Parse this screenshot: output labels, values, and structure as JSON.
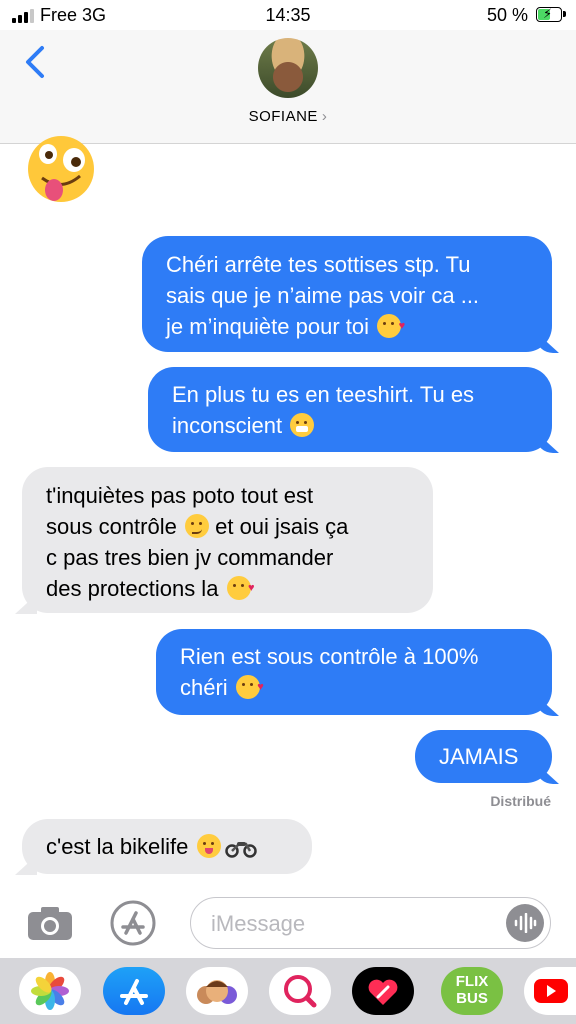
{
  "status_bar": {
    "carrier": "Free",
    "network": "3G",
    "time": "14:35",
    "battery": "50 %",
    "battery_level_percent": 50
  },
  "header": {
    "contact_name": "SOFIANE",
    "chevron": "›",
    "back_icon": "chevron-left-icon",
    "avatar": "contact-photo"
  },
  "conversation": {
    "top_emoji": "zany-face-emoji",
    "messages": [
      {
        "sender": "me",
        "text": "Chéri arrête tes sottises stp. Tu\nsais que je n’aime pas voir ca ...\nje m’inquiète pour toi",
        "emoji": "face-blowing-kiss"
      },
      {
        "sender": "me",
        "text": "En plus tu es en teeshirt. Tu es\ninconscient",
        "emoji": "face-with-steam"
      },
      {
        "sender": "them",
        "text": "t'inquiètes pas poto tout est\nsous contrôle",
        "emoji": "smirking-face",
        "text_after": "et oui jsais ça\nc pas tres bien jv commander\ndes protections la",
        "emoji_after": "face-blowing-kiss"
      },
      {
        "sender": "me",
        "text": "Rien est sous contrôle à 100%\nchéri",
        "emoji": "face-blowing-kiss"
      },
      {
        "sender": "me",
        "text": "JAMAIS"
      },
      {
        "sender": "them",
        "text": "c'est la bikelife",
        "emoji": "yum-face",
        "emoji_2": "motorcycle"
      }
    ],
    "delivery_status": "Distribué"
  },
  "compose": {
    "placeholder": "iMessage",
    "camera_icon": "camera-icon",
    "apps_icon": "app-store-icon",
    "audio_icon": "waveform-icon"
  },
  "app_drawer": {
    "apps": [
      {
        "name": "photos-app-icon"
      },
      {
        "name": "app-store-app-icon"
      },
      {
        "name": "memoji-app-icon"
      },
      {
        "name": "search-images-app-icon"
      },
      {
        "name": "digital-touch-app-icon"
      },
      {
        "name": "flixbus-app-icon",
        "label": "FLIX\nBUS"
      },
      {
        "name": "youtube-app-icon"
      }
    ]
  },
  "colors": {
    "outgoing_bubble": "#2e7cf6",
    "incoming_bubble": "#e9e9eb",
    "accent": "#2e7cf6"
  }
}
